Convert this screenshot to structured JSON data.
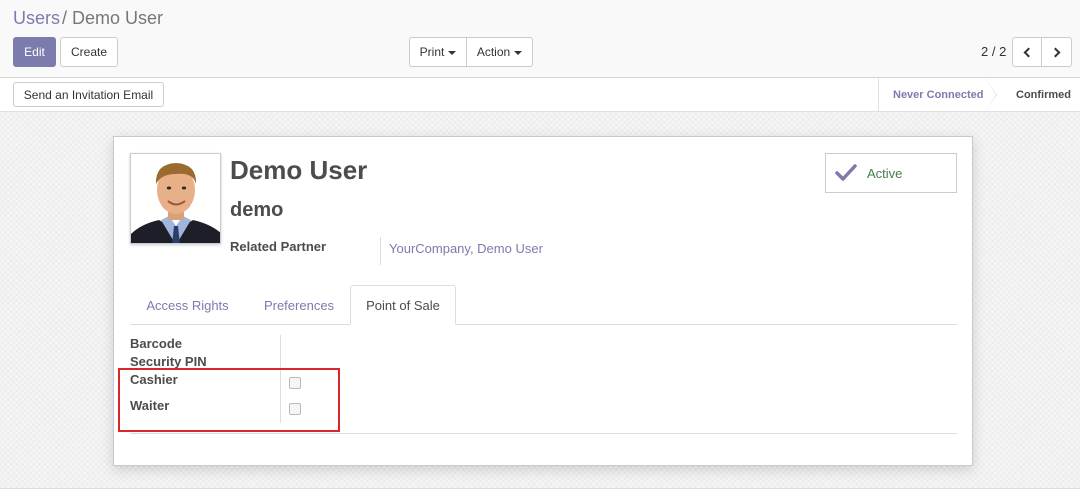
{
  "breadcrumb": {
    "parent": "Users",
    "separator": "/",
    "current": "Demo User"
  },
  "toolbar": {
    "edit_label": "Edit",
    "create_label": "Create",
    "print_label": "Print",
    "action_label": "Action"
  },
  "pager": {
    "value": "2 / 2"
  },
  "statusbar": {
    "invite_label": "Send an Invitation Email",
    "stages": [
      "Never Connected",
      "Confirmed"
    ]
  },
  "user": {
    "name": "Demo User",
    "login": "demo",
    "related_partner_label": "Related Partner",
    "related_partner_value": "YourCompany, Demo User",
    "active_label": "Active"
  },
  "tabs": [
    "Access Rights",
    "Preferences",
    "Point of Sale"
  ],
  "pos_fields": {
    "barcode_label": "Barcode",
    "pin_label": "Security PIN",
    "cashier_label": "Cashier",
    "waiter_label": "Waiter",
    "cashier_checked": false,
    "waiter_checked": false
  },
  "colors": {
    "brand": "#7c7bad",
    "highlight": "#d9262a",
    "active_check": "#7c7bad"
  }
}
